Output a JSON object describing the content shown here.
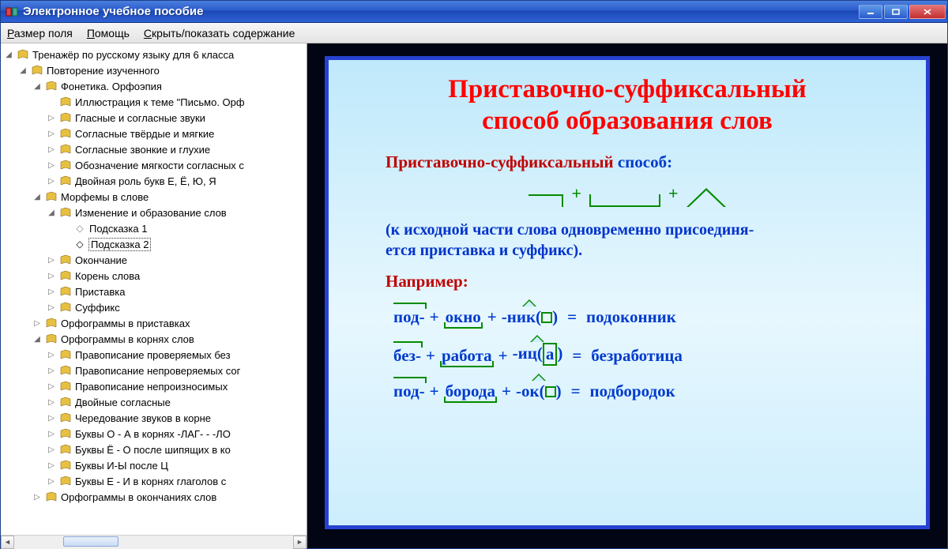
{
  "window": {
    "title": "Электронное учебное пособие"
  },
  "menu": {
    "size": {
      "pre": "Р",
      "post": "азмер поля"
    },
    "help": {
      "pre": "П",
      "post": "омощь"
    },
    "toc": {
      "pre": "С",
      "post": "крыть/показать содержание"
    }
  },
  "tree": {
    "root": "Тренажёр по русскому языку для 6 класса",
    "n1": "Повторение изученного",
    "n2": "Фонетика. Орфоэпия",
    "n2a": "Иллюстрация к теме \"Письмо. Орф",
    "n2b": "Гласные и согласные звуки",
    "n2c": "Согласные твёрдые и мягкие",
    "n2d": "Согласные звонкие и глухие",
    "n2e": "Обозначение мягкости согласных с",
    "n2f": "Двойная роль букв Е, Ё, Ю, Я",
    "n3": "Морфемы в слове",
    "n3a": "Изменение и образование слов",
    "n3a1": "Подсказка 1",
    "n3a2": "Подсказка 2",
    "n3b": "Окончание",
    "n3c": "Корень слова",
    "n3d": "Приставка",
    "n3e": "Суффикс",
    "n4": "Орфограммы в приставках",
    "n5": "Орфограммы в корнях слов",
    "n5a": "Правописание проверяемых без",
    "n5b": "Правописание непроверяемых сог",
    "n5c": "Правописание непроизносимых",
    "n5d": "Двойные согласные",
    "n5e": "Чередование звуков в корне",
    "n5f": "Буквы О - А в корнях -ЛАГ- - -ЛО",
    "n5g": "Буквы Ё - О после шипящих в ко",
    "n5h": "Буквы И-Ы после Ц",
    "n5i": "Буквы Е - И в корнях глаголов с ",
    "n6": "Орфограммы в окончаниях слов"
  },
  "slide": {
    "title1": "Приставочно-суффиксальный",
    "title2": "способ образования слов",
    "sub_red": "Приставочно-суффиксальный",
    "sub_blue": "способ:",
    "explain1": "(к исходной части слова одновременно присоединя-",
    "explain2": "ется приставка и суффикс).",
    "eg": "Например:",
    "ex1": {
      "prefix": "под-",
      "root": "окно",
      "suffix": "-ник(",
      "suffix2": ")",
      "result": "подоконник"
    },
    "ex2": {
      "prefix": "без-",
      "root": "работа",
      "suffix": "-иц(",
      "end": "а",
      "suffix2": ")",
      "result": "безработица"
    },
    "ex3": {
      "prefix": "под-",
      "root": "борода",
      "suffix": "-ок(",
      "suffix2": ")",
      "result": "подбородок"
    },
    "plus": "+",
    "eq": "="
  }
}
